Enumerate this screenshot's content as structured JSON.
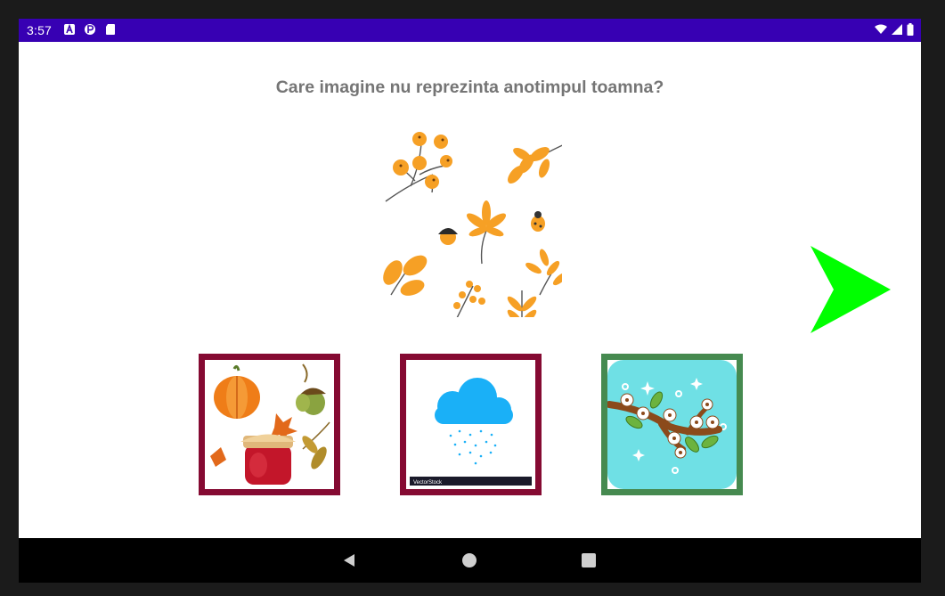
{
  "status_bar": {
    "time": "3:57",
    "left_icons": [
      "a-icon",
      "p-icon",
      "sd-card-icon"
    ],
    "right_icons": [
      "wifi-icon",
      "signal-icon",
      "battery-icon"
    ],
    "background": "#3700b3"
  },
  "quiz": {
    "question": "Care imagine nu reprezinta anotimpul toamna?",
    "hero_image": "autumn-leaves-illustration",
    "next_button_icon": "play-arrow-icon",
    "next_button_color": "#00ff00",
    "options": [
      {
        "image": "pumpkin-jam-acorns-image",
        "border_color": "#850a32",
        "selected": false
      },
      {
        "image": "rain-cloud-image",
        "border_color": "#850a32",
        "selected": false,
        "watermark": "VectorStock"
      },
      {
        "image": "blossoming-branch-image",
        "border_color": "#468a50",
        "selected": true
      }
    ]
  },
  "nav_bar": {
    "buttons": [
      "back-icon",
      "home-icon",
      "recents-icon"
    ]
  }
}
